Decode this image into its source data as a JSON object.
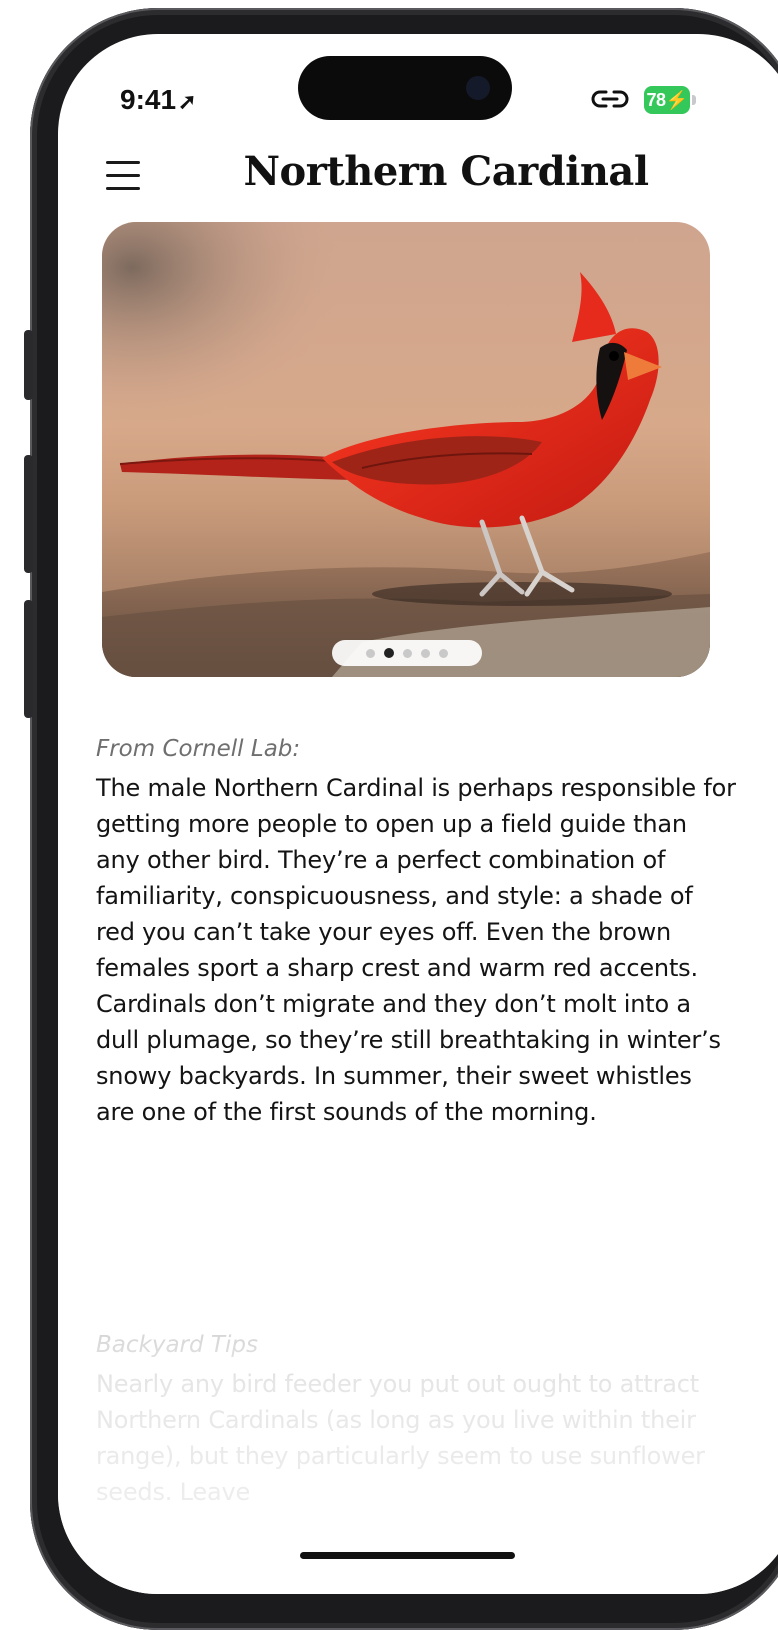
{
  "status_bar": {
    "time": "9:41",
    "battery_level": "78",
    "location_icon": "location-arrow-icon",
    "link_icon": "link-icon"
  },
  "header": {
    "title": "Northern Cardinal",
    "menu_icon": "hamburger-menu-icon"
  },
  "gallery": {
    "image_subject": "bird photo",
    "page_count": 5,
    "active_index": 1
  },
  "description": {
    "source_label": "From Cornell Lab:",
    "text": "The male Northern Cardinal is perhaps responsible for getting more people to open up a field guide than any other bird. They’re a perfect combination of familiarity, conspicuousness, and style: a shade of red you can’t take your eyes off. Even the brown females sport a sharp crest and warm red accents. Cardinals don’t migrate and they don’t molt into a dull plumage, so they’re still breathtaking in winter’s snowy backyards. In summer, their sweet whistles are one of the first sounds of the morning."
  },
  "backyard_tips": {
    "label": "Backyard Tips",
    "text": "Nearly any bird feeder you put out ought to attract Northern Cardinals (as long as you live within their range), but they particularly seem to use sunflower seeds. Leave"
  },
  "colors": {
    "battery": "#34c759",
    "cardinal_red": "#d92a1e",
    "title": "#111111"
  }
}
